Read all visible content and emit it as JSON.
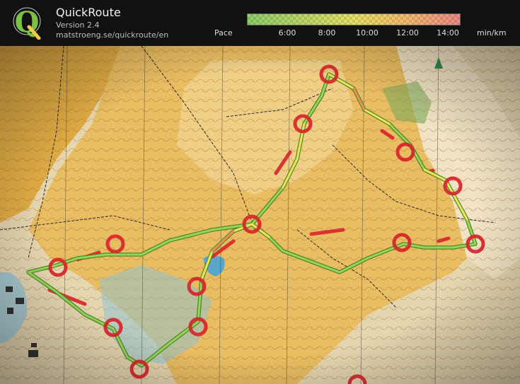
{
  "header": {
    "title": "QuickRoute",
    "version": "Version 2.4",
    "url": "matstroeng.se/quickroute/en",
    "pace_label": "Pace",
    "unit": "min/km",
    "ticks": [
      "6:00",
      "8:00",
      "10:00",
      "12:00",
      "14:00"
    ],
    "logo_letter": "Q"
  },
  "colors": {
    "header_bg": "#111111",
    "map_paper": "#e8d8b0",
    "terrain_yellow": "#e3b24f",
    "control_red": "#d8242a",
    "route_green": "#6fbf3a",
    "route_yellow": "#f2e25a",
    "contour_brown": "#9a5a28",
    "water_blue": "#5aa6c8"
  }
}
